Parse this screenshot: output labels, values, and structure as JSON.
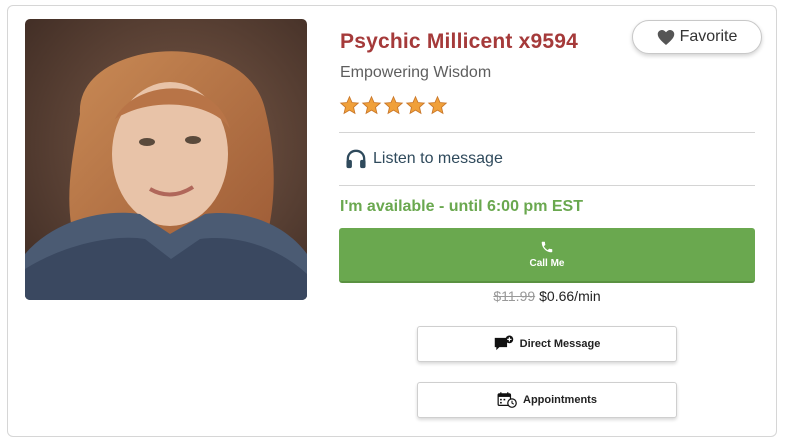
{
  "advisor": {
    "name": "Psychic Millicent x9594",
    "tagline": "Empowering Wisdom",
    "rating": 5,
    "rating_max": 5,
    "photo_icon": "advisor-portrait"
  },
  "actions": {
    "favorite_label": "Favorite",
    "listen_label": "Listen to message",
    "call_label": "Call Me",
    "direct_message_label": "Direct Message",
    "appointments_label": "Appointments"
  },
  "status": {
    "availability": "I'm available - until 6:00 pm EST"
  },
  "pricing": {
    "original": "$11.99",
    "current": "$0.66/min"
  },
  "colors": {
    "name": "#a53a3a",
    "accent_green": "#6aa84f",
    "star": "#f0a03a",
    "text_dark": "#2f4a5c"
  }
}
